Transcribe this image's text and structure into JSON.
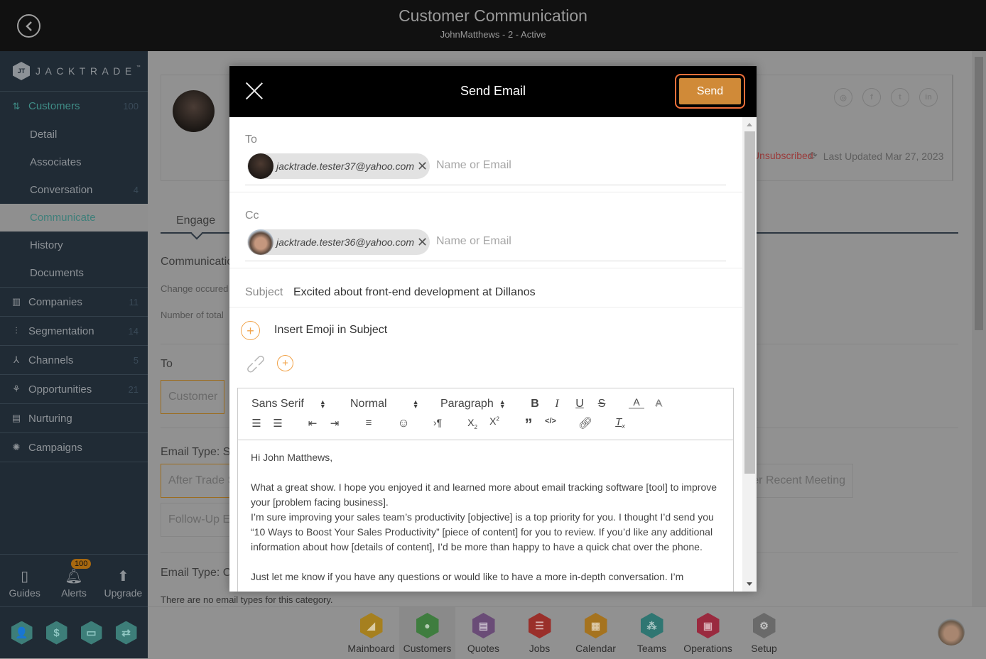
{
  "topbar": {
    "title": "Customer Communication",
    "subtitle": "JohnMatthews - 2 - Active",
    "back_icon": "chevron-left-circle-icon"
  },
  "sidebar": {
    "logo_text": "JACKTRADE",
    "logo_tm": "™",
    "logo_mark": "JT",
    "customers": {
      "label": "Customers",
      "count": "100",
      "icon": "customers-icon"
    },
    "sub_items": [
      {
        "label": "Detail",
        "count": ""
      },
      {
        "label": "Associates",
        "count": ""
      },
      {
        "label": "Conversation",
        "count": "4"
      },
      {
        "label": "Communicate",
        "count": "",
        "active": true
      },
      {
        "label": "History",
        "count": ""
      },
      {
        "label": "Documents",
        "count": ""
      }
    ],
    "items": [
      {
        "label": "Companies",
        "count": "11",
        "icon": "building-icon"
      },
      {
        "label": "Segmentation",
        "count": "14",
        "icon": "segmentation-icon"
      },
      {
        "label": "Channels",
        "count": "5",
        "icon": "channels-icon"
      },
      {
        "label": "Opportunities",
        "count": "21",
        "icon": "opportunities-icon"
      },
      {
        "label": "Nurturing",
        "count": "",
        "icon": "nurturing-icon"
      },
      {
        "label": "Campaigns",
        "count": "",
        "icon": "campaigns-icon"
      }
    ],
    "tools": [
      {
        "label": "Guides",
        "icon": "book-icon"
      },
      {
        "label": "Alerts",
        "icon": "bell-icon",
        "badge": "100"
      },
      {
        "label": "Upgrade",
        "icon": "arrow-up-icon"
      }
    ],
    "quick_apps": [
      {
        "name": "person",
        "glyph": "👤"
      },
      {
        "name": "dollar",
        "glyph": "$"
      },
      {
        "name": "money",
        "glyph": "▭"
      },
      {
        "name": "workflow",
        "glyph": "⇄"
      }
    ]
  },
  "background": {
    "social": [
      "◎",
      "f",
      "t",
      "in"
    ],
    "unsubscribed": "Unsubscribed",
    "last_updated": "Last Updated Mar 27, 2023",
    "tab": "Engage",
    "communication_heading": "Communication",
    "change_occured": "Change occured",
    "number_of_total": "Number of total",
    "to_label": "To",
    "to_button": "Customer",
    "email_type_s": "Email Type: S",
    "after_trade": "After Trade S",
    "follow_up": "Follow-Up E",
    "recent_meeting": "er Recent Meeting",
    "email_type_c": "Email Type: C",
    "no_email_types": "There are no email types for this category."
  },
  "bottom_apps": [
    {
      "label": "Mainboard",
      "color": "#a6801f",
      "glyph": "◢"
    },
    {
      "label": "Customers",
      "color": "#3f7d3f",
      "glyph": "●",
      "active": true
    },
    {
      "label": "Quotes",
      "color": "#6a4c77",
      "glyph": "▤"
    },
    {
      "label": "Jobs",
      "color": "#9a2f2a",
      "glyph": "☰"
    },
    {
      "label": "Calendar",
      "color": "#a5731f",
      "glyph": "▦"
    },
    {
      "label": "Teams",
      "color": "#2f7672",
      "glyph": "⁂"
    },
    {
      "label": "Operations",
      "color": "#9a2a3f",
      "glyph": "▣"
    },
    {
      "label": "Setup",
      "color": "#6a6a6a",
      "glyph": "⚙"
    }
  ],
  "modal": {
    "title": "Send Email",
    "send_label": "Send",
    "to_label": "To",
    "to_chip": "jacktrade.tester37@yahoo.com",
    "to_placeholder": "Name or Email",
    "cc_label": "Cc",
    "cc_chip": "jacktrade.tester36@yahoo.com",
    "cc_placeholder": "Name or Email",
    "subject_label": "Subject",
    "subject_value": "Excited about front-end development at Dillanos",
    "emoji_label": "Insert Emoji in Subject",
    "editor": {
      "font": "Sans Serif",
      "size": "Normal",
      "block": "Paragraph",
      "body": [
        "Hi John Matthews,",
        "",
        "What a great show. I hope you enjoyed it and learned more about email tracking software [tool] to improve your [problem facing business].",
        "I’m sure improving your sales team’s productivity [objective] is a top priority for you. I thought I’d send you “10 Ways to Boost Your Sales Productivity” [piece of content] for you to review. If you’d like any additional information about how [details of content], I’d be more than happy to have a quick chat over the phone.",
        "",
        "Just let me know if you have any questions or would like to have a more in-depth conversation. I’m"
      ]
    }
  }
}
